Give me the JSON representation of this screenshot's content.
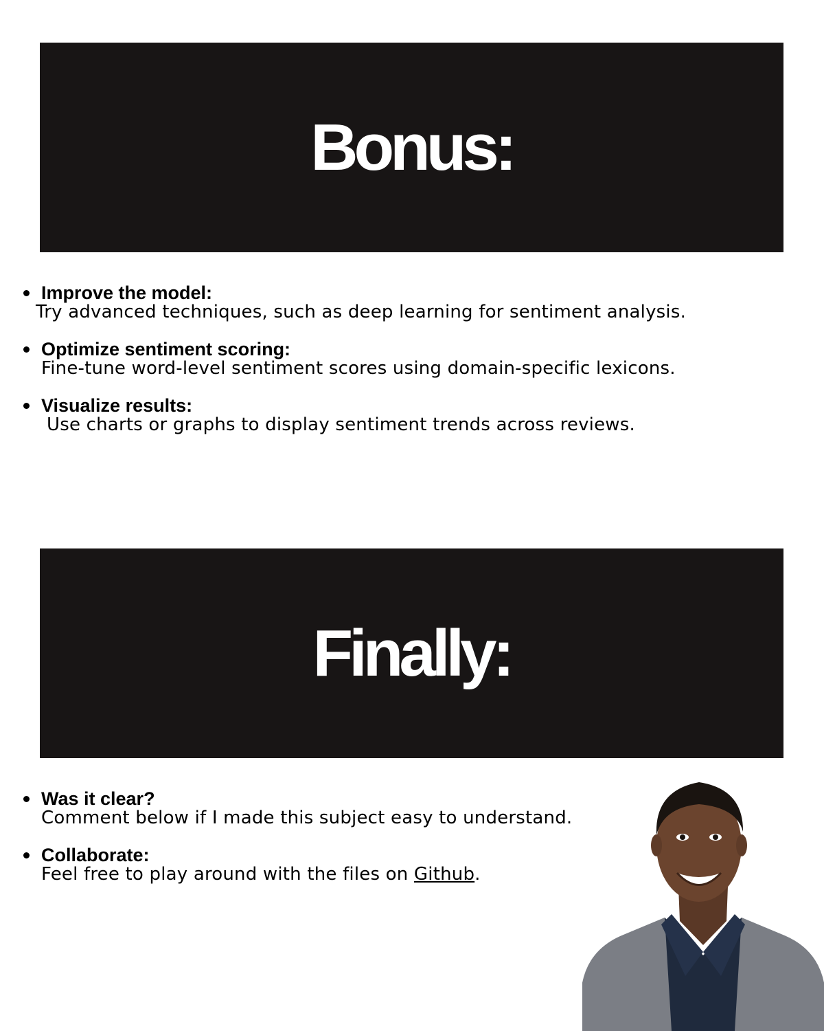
{
  "bonus": {
    "title": "Bonus:",
    "items": [
      {
        "heading": "Improve the model:",
        "desc": "Try advanced techniques, such as deep learning for sentiment analysis."
      },
      {
        "heading": "Optimize sentiment scoring:",
        "desc": "Fine-tune word-level sentiment scores using domain-specific lexicons."
      },
      {
        "heading": "Visualize results:",
        "desc": "Use charts or graphs to display sentiment trends across reviews."
      }
    ]
  },
  "finally": {
    "title": "Finally:",
    "items": [
      {
        "heading": "Was it clear?",
        "desc": "Comment below if I made this subject easy to understand."
      },
      {
        "heading": "Collaborate:",
        "desc_before": "Feel free to play around with the files on ",
        "link": "Github",
        "desc_after": "."
      }
    ]
  },
  "colors": {
    "banner": "#181515",
    "banner_text": "#ffffff",
    "text": "#000000"
  },
  "icons": {
    "portrait": "person-photo"
  }
}
